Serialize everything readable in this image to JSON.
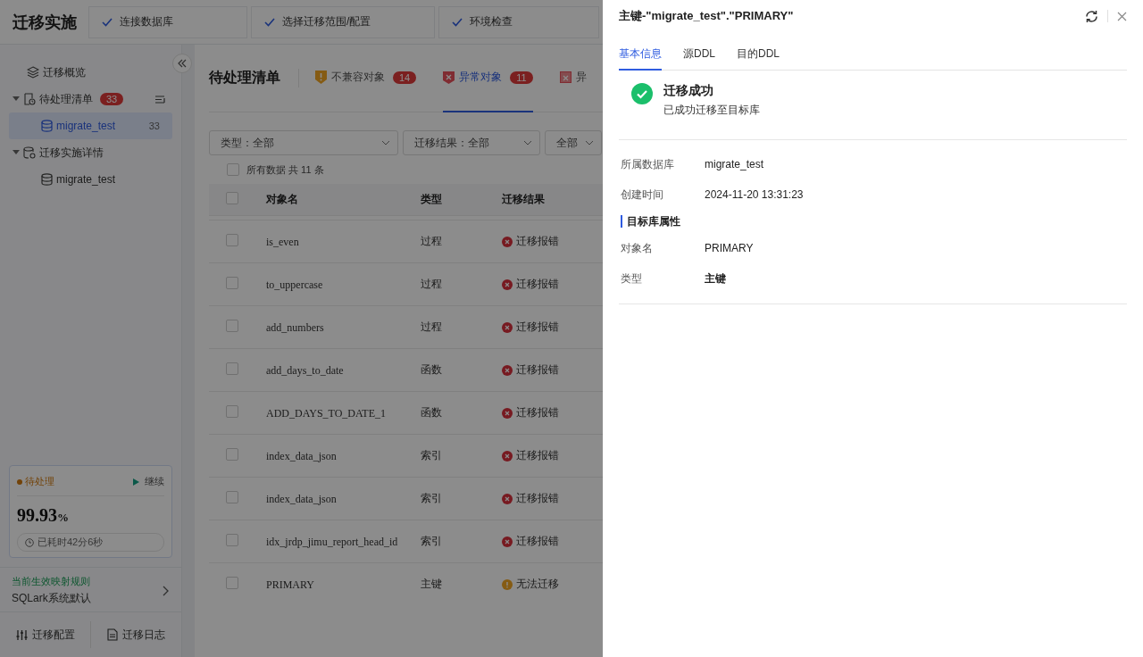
{
  "app_title": "迁移实施",
  "steps": [
    {
      "label": "连接数据库",
      "done": true
    },
    {
      "label": "选择迁移范围/配置",
      "done": true
    },
    {
      "label": "环境检查",
      "done": true
    }
  ],
  "sidebar": {
    "items": [
      {
        "label": "迁移概览",
        "kind": "overview",
        "selected": false
      },
      {
        "label": "待处理清单",
        "kind": "pending",
        "badge": "33",
        "expanded": true,
        "children": [
          {
            "label": "migrate_test",
            "count": "33",
            "selected": true
          }
        ]
      },
      {
        "label": "迁移实施详情",
        "kind": "detail",
        "expanded": true,
        "children": [
          {
            "label": "migrate_test",
            "selected": false
          }
        ]
      }
    ]
  },
  "status_card": {
    "status": "待处理",
    "action": "继续",
    "percent": "99.93",
    "unit": "%",
    "elapsed": "已耗时42分6秒"
  },
  "mapping_rule": {
    "caption": "当前生效映射规则",
    "value": "SQLark系统默认"
  },
  "footer_buttons": [
    {
      "label": "迁移配置",
      "kind": "config"
    },
    {
      "label": "迁移日志",
      "kind": "log"
    }
  ],
  "main": {
    "title": "待处理清单",
    "tabs": [
      {
        "label": "不兼容对象",
        "count": "14",
        "kind": "warn",
        "selected": false
      },
      {
        "label": "异常对象",
        "count": "11",
        "kind": "error",
        "selected": true
      },
      {
        "label": "异",
        "kind": "error2",
        "selected": false
      }
    ],
    "filters": [
      {
        "label": "类型：全部"
      },
      {
        "label": "迁移结果：全部"
      },
      {
        "label": "全部"
      }
    ],
    "select_all": {
      "label": "所有数据 共 11 条",
      "checked": false
    },
    "table": {
      "header_checked": false,
      "columns": [
        "对象名",
        "类型",
        "迁移结果"
      ],
      "rows": [
        {
          "name": "is_even",
          "type": "过程",
          "result": "迁移报错",
          "kind": "error",
          "checked": false
        },
        {
          "name": "to_uppercase",
          "type": "过程",
          "result": "迁移报错",
          "kind": "error",
          "checked": false
        },
        {
          "name": "add_numbers",
          "type": "过程",
          "result": "迁移报错",
          "kind": "error",
          "checked": false
        },
        {
          "name": "add_days_to_date",
          "type": "函数",
          "result": "迁移报错",
          "kind": "error",
          "checked": false
        },
        {
          "name": "ADD_DAYS_TO_DATE_1",
          "type": "函数",
          "result": "迁移报错",
          "kind": "error",
          "checked": false
        },
        {
          "name": "index_data_json",
          "type": "索引",
          "result": "迁移报错",
          "kind": "error",
          "checked": false
        },
        {
          "name": "index_data_json",
          "type": "索引",
          "result": "迁移报错",
          "kind": "error",
          "checked": false
        },
        {
          "name": "idx_jrdp_jimu_report_head_id",
          "type": "索引",
          "result": "迁移报错",
          "kind": "error",
          "checked": false
        },
        {
          "name": "PRIMARY",
          "type": "主键",
          "result": "无法迁移",
          "kind": "warn",
          "checked": false
        }
      ]
    }
  },
  "drawer": {
    "title": "主键-\"migrate_test\".\"PRIMARY\"",
    "tabs": [
      {
        "label": "基本信息",
        "selected": true
      },
      {
        "label": "源DDL",
        "selected": false
      },
      {
        "label": "目的DDL",
        "selected": false
      }
    ],
    "result": {
      "title": "迁移成功",
      "message": "已成功迁移至目标库",
      "kind": "success"
    },
    "fields": [
      {
        "label": "所属数据库",
        "value": "migrate_test"
      },
      {
        "label": "创建时间",
        "value": "2024-11-20 13:31:23"
      }
    ],
    "section_title": "目标库属性",
    "target_fields": [
      {
        "label": "对象名",
        "value": "PRIMARY",
        "bold": false
      },
      {
        "label": "类型",
        "value": "主键",
        "bold": true
      }
    ]
  }
}
